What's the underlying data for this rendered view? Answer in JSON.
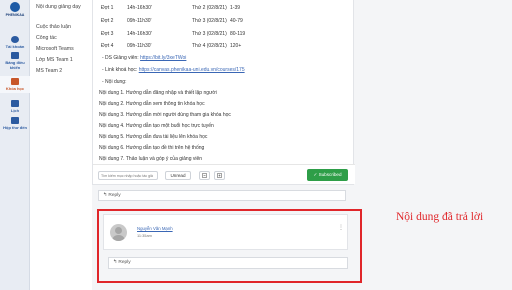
{
  "brand": {
    "logo_text": "PHENIKAA"
  },
  "rail": {
    "items": [
      {
        "label": "Tài khoản",
        "icon": "account-icon"
      },
      {
        "label": "Bảng điều khiển",
        "icon": "dashboard-icon"
      },
      {
        "label": "Khóa học",
        "icon": "courses-icon"
      },
      {
        "label": "Lịch",
        "icon": "calendar-icon"
      },
      {
        "label": "Hộp thư đến",
        "icon": "inbox-icon"
      }
    ],
    "active_index": 2
  },
  "channels": [
    "Nội dung giảng dạy",
    "Cuộc thảo luận",
    "Công tác",
    "Microsoft Teams",
    "Lớp MS Team 1",
    "MS Team 2"
  ],
  "schedule": [
    {
      "dot": "Đợt 1",
      "time": "14h-16h30'",
      "date": "Thứ 2 (02/8/21)",
      "range": "1-39"
    },
    {
      "dot": "Đợt 2",
      "time": "09h-11h30'",
      "date": "Thứ 3 (02/8/21)",
      "range": "40-79"
    },
    {
      "dot": "Đợt 3",
      "time": "14h-16h30'",
      "date": "Thứ 3 (02/8/21)",
      "range": "80-119"
    },
    {
      "dot": "Đợt 4",
      "time": "09h-11h30'",
      "date": "Thứ 4 (02/8/21)",
      "range": "120+"
    }
  ],
  "links": {
    "ds_label": "- DS Giảng viên:",
    "ds_url": "https://bit.ly/3xeTWoi",
    "course_label": "- Link khoá học:",
    "course_url": "https://canvas.phenikaa-uni.edu.vn/courses/175"
  },
  "content": {
    "heading": "- Nội dung:",
    "items": [
      "Nội dung 1. Hướng dẫn đăng nhập và thiết lập người",
      "Nội dung 2. Hướng dẫn xem thông tin khóa học",
      "Nội dung 3. Hướng dẫn mời người dùng tham gia khóa học",
      "Nội dung 4. Hướng dẫn tạo một buổi học trực tuyến",
      "Nội dung 5. Hướng dẫn đưa tài liệu lên khóa học",
      "Nội dung 6. Hướng dẫn tạo đề thi trên hệ thống",
      "Nội dung 7. Thảo luận và góp ý của giảng viên"
    ]
  },
  "toolbar": {
    "search_placeholder": "Tìm kiếm mục nhập hoặc tác giả",
    "unread_label": "Unread",
    "subscribed_label": "✓ Subscribed"
  },
  "reply_label": "↰ Reply",
  "comment": {
    "author": "Nguyễn Văn Mạnh",
    "time": "11:35am"
  },
  "annotation": "Nội dung đã trả lời",
  "colors": {
    "brand": "#1c5aa6",
    "subscribed": "#2e9e48",
    "highlight": "#e0262a",
    "link": "#3a67b5"
  }
}
